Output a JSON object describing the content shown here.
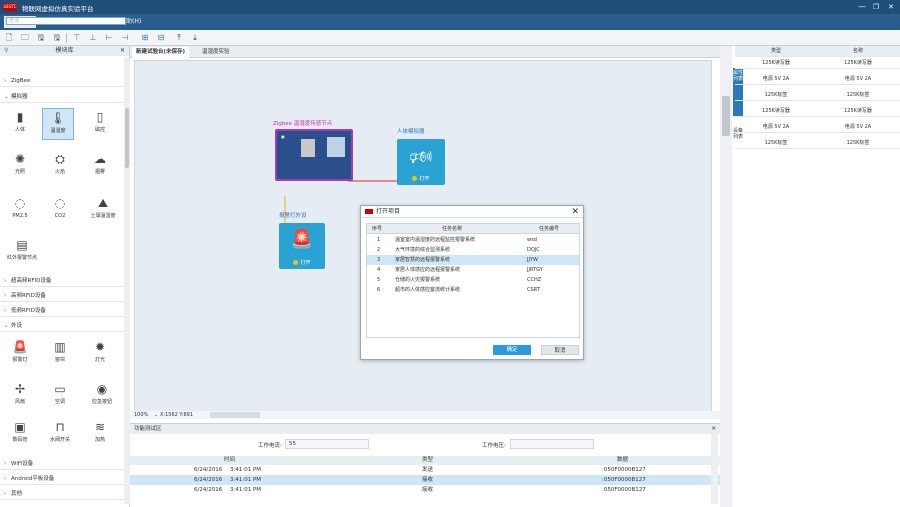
{
  "app": {
    "title": "物联网虚拟仿真实验平台",
    "logo_text": "UESTC"
  },
  "window_controls": {
    "minimize": "—",
    "restore": "❐",
    "close": "✕"
  },
  "menu": [
    "开始(F)",
    "布局(L)",
    "视图(V)",
    "帮助(H)"
  ],
  "left_panel": {
    "title": "模块库",
    "search_placeholder": "查询",
    "categories": {
      "zigbee": "ZigBee",
      "sensors": "模拟器",
      "rfid_125": "超高频RFID设备",
      "rfid_hf": "高频RFID设备",
      "rfid_lf": "低频RFID设备",
      "actuators": "外设",
      "wifi": "WiFi设备",
      "android": "Android平板设备",
      "other": "其他"
    },
    "sensor_items": [
      "人体",
      "温湿度",
      "磁控",
      "光照",
      "火焰",
      "烟雾",
      "PM2.5",
      "CO2",
      "土壤温湿度",
      "红外报警节点"
    ],
    "actuator_items": [
      "报警灯",
      "窗帘",
      "灯光",
      "风扇",
      "空调",
      "应急按钮",
      "数码管",
      "水阀开关",
      "加热"
    ]
  },
  "tabs": [
    "新建试验台(未保存)",
    "温湿度实验"
  ],
  "canvas": {
    "node_zigbee_label": "Zigbee 温湿度传感节点",
    "node_body_label": "人体模拟器",
    "node_alarm_label": "报警灯外设",
    "node_button": "打开",
    "zoom": "100%",
    "status": "X:1562 Y:891"
  },
  "dialog": {
    "title": "打开项目",
    "columns": [
      "序号",
      "任务名称",
      "任务编号"
    ],
    "rows": [
      {
        "no": "1",
        "name": "温室室内温湿度的远程监控报警系统",
        "code": "wsd"
      },
      {
        "no": "2",
        "name": "大气环境的综合监测系统",
        "code": "DQJC"
      },
      {
        "no": "3",
        "name": "家居智慧的远程报警系统",
        "code": "JJYW"
      },
      {
        "no": "4",
        "name": "家居人体感应的远程报警系统",
        "code": "JJRTGY"
      },
      {
        "no": "5",
        "name": "仓储的火灾报警系统",
        "code": "CCHZ"
      },
      {
        "no": "6",
        "name": "超市的人体感应客流统计系统",
        "code": "CSRT"
      }
    ],
    "ok": "确定",
    "cancel": "取消"
  },
  "right_panel": {
    "tabs": [
      "属性列表",
      "设备列表"
    ],
    "columns": [
      "类型",
      "名称"
    ],
    "rows": [
      {
        "type": "125K读写器",
        "name": "125K读写器"
      },
      {
        "type": "电源 5V 2A",
        "name": "电源 5V 2A"
      },
      {
        "type": "125K标签",
        "name": "125K标签"
      },
      {
        "type": "125K读写器",
        "name": "125K读写器"
      },
      {
        "type": "电源 5V 2A",
        "name": "电源 5V 2A"
      },
      {
        "type": "125K标签",
        "name": "125K标签"
      }
    ]
  },
  "bottom": {
    "title": "功能测试区",
    "current_label": "工作电流:",
    "current_value": "55",
    "voltage_label": "工作电压:",
    "voltage_value": "",
    "log_columns": [
      "时间",
      "类型",
      "数据"
    ],
    "log_rows": [
      {
        "date": "6/24/2016",
        "time": "3:41:01 PM",
        "type": "发送",
        "data": ":050F0000B127"
      },
      {
        "date": "6/24/2016",
        "time": "3:41:01 PM",
        "type": "接收",
        "data": ":050F0000B127"
      },
      {
        "date": "6/24/2016",
        "time": "3:41:01 PM",
        "type": "接收",
        "data": ":050F0000B127"
      }
    ]
  }
}
